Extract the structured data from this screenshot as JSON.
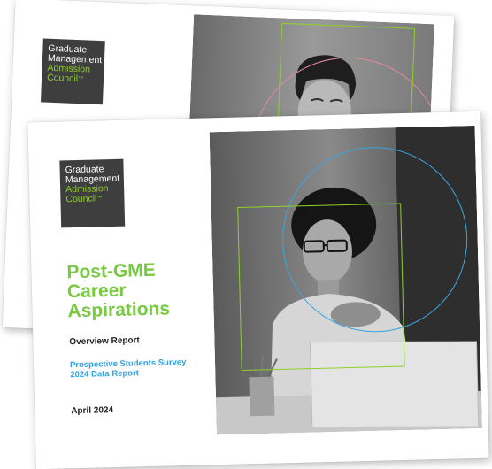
{
  "back_cover": {
    "logo": {
      "line1": "Graduate",
      "line2": "Management",
      "line3": "Admission",
      "line4": "Council",
      "mark": "™"
    }
  },
  "front_cover": {
    "logo": {
      "line1": "Graduate",
      "line2": "Management",
      "line3": "Admission",
      "line4": "Council",
      "mark": "™"
    },
    "title": {
      "line1": "Post-GME",
      "line2": "Career",
      "line3": "Aspirations"
    },
    "subtitle": "Overview Report",
    "survey": {
      "line1": "Prospective Students Survey",
      "line2": "2024 Data Report"
    },
    "date": "April 2024"
  },
  "colors": {
    "accent_green": "#7ac943",
    "accent_blue": "#2fa3e6",
    "logo_bg": "#3e3e3e"
  }
}
